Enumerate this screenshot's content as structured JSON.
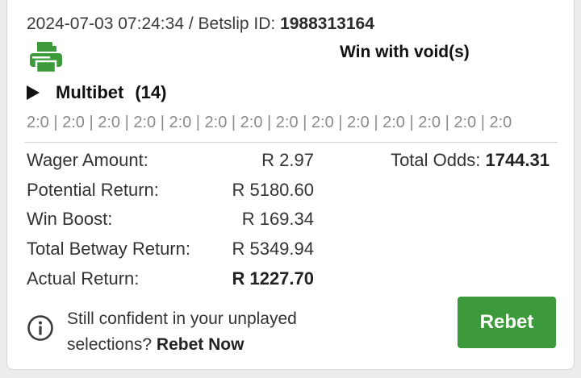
{
  "header": {
    "datetime": "2024-07-03 07:24:34",
    "separator": "/",
    "betslip_label": "Betslip ID:",
    "betslip_id": "1988313164"
  },
  "status_text": "Win with void(s)",
  "bet": {
    "type_label": "Multibet",
    "count": "(14)",
    "scores": "2:0 | 2:0 | 2:0 | 2:0 | 2:0 | 2:0 | 2:0 | 2:0 | 2:0 | 2:0 | 2:0 | 2:0 | 2:0 | 2:0"
  },
  "details": [
    {
      "label": "Wager Amount:",
      "value": "R 2.97"
    },
    {
      "label": "Potential Return:",
      "value": "R 5180.60"
    },
    {
      "label": "Win Boost:",
      "value": "R 169.34"
    },
    {
      "label": "Total Betway Return:",
      "value": "R 5349.94"
    },
    {
      "label": "Actual Return:",
      "value": "R 1227.70"
    }
  ],
  "odds": {
    "label": "Total Odds:",
    "value": "1744.31"
  },
  "promo": {
    "line1": "Still confident in your unplayed",
    "line2": "selections?",
    "cta": "Rebet Now"
  },
  "rebet_label": "Rebet",
  "colors": {
    "accent": "#3d9a3a",
    "print_icon": "#3d9a3a"
  },
  "icons": [
    "printer-icon",
    "play-triangle-icon",
    "info-icon"
  ]
}
